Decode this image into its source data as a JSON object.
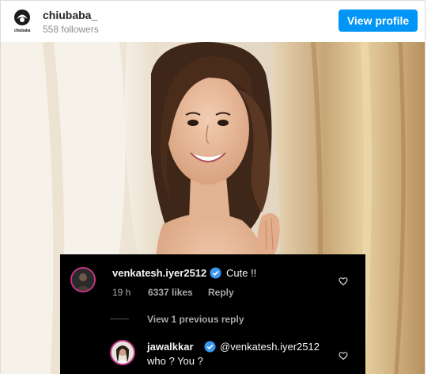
{
  "header": {
    "username": "chiubaba_",
    "followers": "558 followers",
    "view_profile_label": "View profile",
    "avatar_caption": "chiubaba"
  },
  "comments": {
    "first": {
      "username": "venkatesh.iyer2512",
      "text": "Cute !!",
      "time": "19 h",
      "likes": "6337 likes",
      "reply": "Reply"
    },
    "view_previous": "View 1 previous reply",
    "second": {
      "username": "jawalkkar",
      "mention": "@venkatesh.iyer2512",
      "text": "who ? You ?"
    }
  },
  "colors": {
    "accent": "#0095f6",
    "verified": "#3897f0"
  }
}
